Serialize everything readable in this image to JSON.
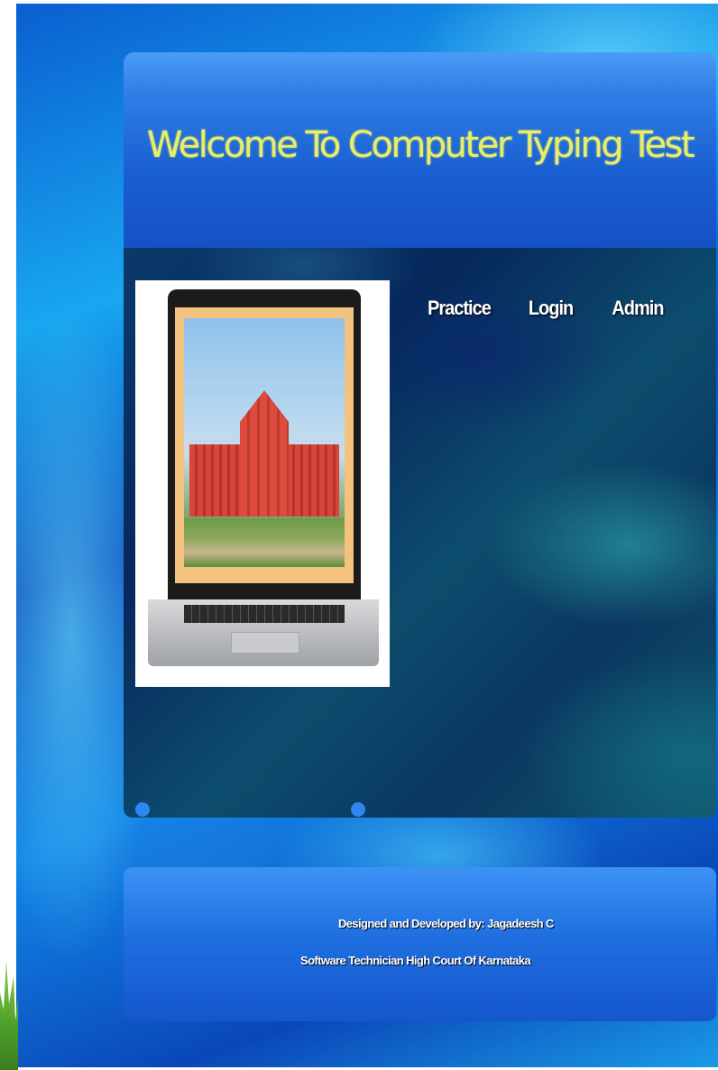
{
  "header": {
    "title": "Welcome To Computer Typing Test"
  },
  "nav": {
    "items": [
      {
        "label": "Practice"
      },
      {
        "label": "Login"
      },
      {
        "label": "Admin"
      }
    ]
  },
  "hero": {
    "image": "laptop-showing-high-court-building"
  },
  "footer": {
    "credit": "Designed and Developed by: Jagadeesh C",
    "role": "Software Technician High Court Of Karnataka"
  },
  "colors": {
    "title": "#e7ee6a",
    "panel_blue": "#1a5fd2",
    "nav_text": "#ffffff"
  }
}
